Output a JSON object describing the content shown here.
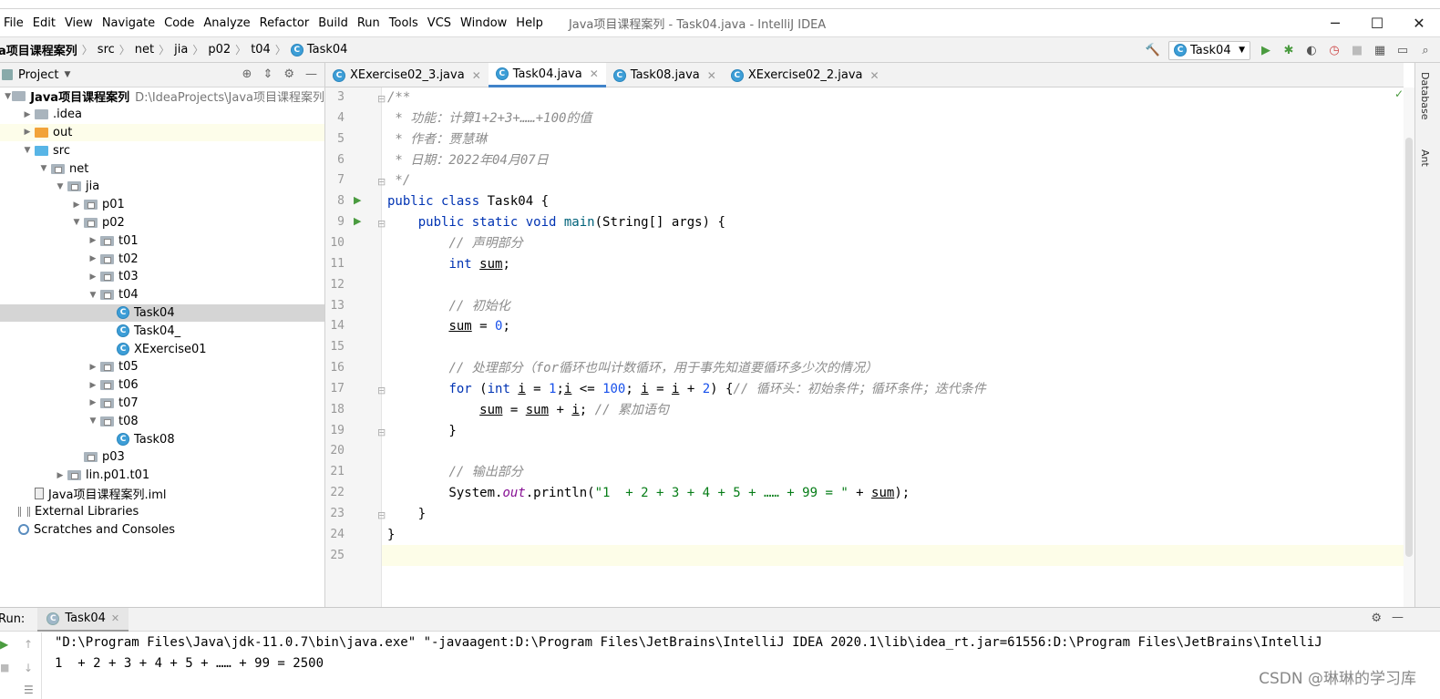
{
  "window": {
    "title": "Java项目课程案列 - Task04.java - IntelliJ IDEA",
    "menu": [
      "File",
      "Edit",
      "View",
      "Navigate",
      "Code",
      "Analyze",
      "Refactor",
      "Build",
      "Run",
      "Tools",
      "VCS",
      "Window",
      "Help"
    ],
    "controls": {
      "minimize": "─",
      "maximize": "☐",
      "close": "✕"
    }
  },
  "navbar": {
    "breadcrumbs": [
      "a项目课程案列",
      "src",
      "net",
      "jia",
      "p02",
      "t04",
      "Task04"
    ],
    "run_config": "Task04"
  },
  "project_panel": {
    "title": "Project",
    "tree": [
      {
        "label": "Java项目课程案列",
        "hint": "D:\\IdeaProjects\\Java项目课程案列",
        "depth": 0,
        "arrow": "▼",
        "icon": "folder",
        "bold": true
      },
      {
        "label": ".idea",
        "depth": 1,
        "arrow": "▶",
        "icon": "folder"
      },
      {
        "label": "out",
        "depth": 1,
        "arrow": "▶",
        "icon": "folder-orange",
        "highlight": true
      },
      {
        "label": "src",
        "depth": 1,
        "arrow": "▼",
        "icon": "folder-blue"
      },
      {
        "label": "net",
        "depth": 2,
        "arrow": "▼",
        "icon": "package"
      },
      {
        "label": "jia",
        "depth": 3,
        "arrow": "▼",
        "icon": "package"
      },
      {
        "label": "p01",
        "depth": 4,
        "arrow": "▶",
        "icon": "package"
      },
      {
        "label": "p02",
        "depth": 4,
        "arrow": "▼",
        "icon": "package"
      },
      {
        "label": "t01",
        "depth": 5,
        "arrow": "▶",
        "icon": "package"
      },
      {
        "label": "t02",
        "depth": 5,
        "arrow": "▶",
        "icon": "package"
      },
      {
        "label": "t03",
        "depth": 5,
        "arrow": "▶",
        "icon": "package"
      },
      {
        "label": "t04",
        "depth": 5,
        "arrow": "▼",
        "icon": "package"
      },
      {
        "label": "Task04",
        "depth": 6,
        "arrow": "",
        "icon": "class",
        "selected": true
      },
      {
        "label": "Task04_",
        "depth": 6,
        "arrow": "",
        "icon": "class"
      },
      {
        "label": "XExercise01",
        "depth": 6,
        "arrow": "",
        "icon": "class"
      },
      {
        "label": "t05",
        "depth": 5,
        "arrow": "▶",
        "icon": "package"
      },
      {
        "label": "t06",
        "depth": 5,
        "arrow": "▶",
        "icon": "package"
      },
      {
        "label": "t07",
        "depth": 5,
        "arrow": "▶",
        "icon": "package"
      },
      {
        "label": "t08",
        "depth": 5,
        "arrow": "▼",
        "icon": "package"
      },
      {
        "label": "Task08",
        "depth": 6,
        "arrow": "",
        "icon": "class"
      },
      {
        "label": "p03",
        "depth": 4,
        "arrow": "",
        "icon": "package"
      },
      {
        "label": "lin.p01.t01",
        "depth": 3,
        "arrow": "▶",
        "icon": "package"
      },
      {
        "label": "Java项目课程案列.iml",
        "depth": 1,
        "arrow": "",
        "icon": "file"
      },
      {
        "label": "External Libraries",
        "depth": 0,
        "arrow": "",
        "icon": "lib"
      },
      {
        "label": "Scratches and Consoles",
        "depth": 0,
        "arrow": "",
        "icon": "scratch"
      }
    ]
  },
  "tabs": [
    {
      "label": "XExercise02_3.java",
      "active": false
    },
    {
      "label": "Task04.java",
      "active": true
    },
    {
      "label": "Task08.java",
      "active": false
    },
    {
      "label": "XExercise02_2.java",
      "active": false
    }
  ],
  "editor": {
    "line_numbers": [
      "3",
      "4",
      "5",
      "6",
      "7",
      "8",
      "9",
      "10",
      "11",
      "12",
      "13",
      "14",
      "15",
      "16",
      "17",
      "18",
      "19",
      "20",
      "21",
      "22",
      "23",
      "24",
      "25"
    ],
    "comment_func": " * 功能：计算1+2+3+……+100的值",
    "comment_author": " * 作者：贾慧琳",
    "comment_date": " * 日期：2022年04月07日",
    "c_decl": "// 声明部分",
    "c_init": "// 初始化",
    "c_proc": "// 处理部分（for循环也叫计数循环，用于事先知道要循环多少次的情况）",
    "c_loophead": "// 循环头：初始条件；循环条件；迭代条件",
    "c_acc": "// 累加语句",
    "c_out": "// 输出部分",
    "print_str": "\"1  + 2 + 3 + 4 + 5 + …… + 99 = \""
  },
  "right_tools": [
    "Database",
    "Ant"
  ],
  "run_panel": {
    "label": "Run:",
    "tab": "Task04",
    "cmd_line": "\"D:\\Program Files\\Java\\jdk-11.0.7\\bin\\java.exe\" \"-javaagent:D:\\Program Files\\JetBrains\\IntelliJ IDEA 2020.1\\lib\\idea_rt.jar=61556:D:\\Program Files\\JetBrains\\IntelliJ",
    "output": "1  + 2 + 3 + 4 + 5 + …… + 99 = 2500"
  },
  "watermark": "CSDN @琳琳的学习库"
}
